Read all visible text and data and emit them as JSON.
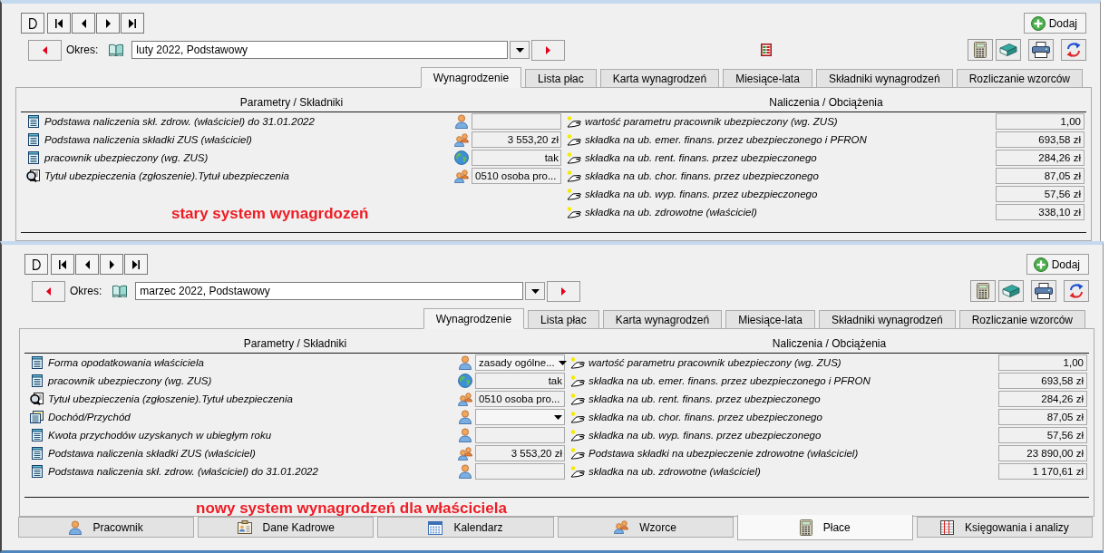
{
  "screens": [
    {
      "period": {
        "label": "Okres:",
        "value": "luty 2022, Podstawowy"
      },
      "indicator": true,
      "add_button": "Dodaj",
      "tabs": [
        {
          "label": "Wynagrodzenie",
          "selected": true
        },
        {
          "label": "Lista płac",
          "selected": false
        },
        {
          "label": "Karta wynagrodzeń",
          "selected": false
        },
        {
          "label": "Miesiące-lata",
          "selected": false
        },
        {
          "label": "Składniki wynagrodzeń",
          "selected": false
        },
        {
          "label": "Rozliczanie wzorców",
          "selected": false
        }
      ],
      "columns": {
        "left": "Parametry / Składniki",
        "right": "Naliczenia / Obciążenia"
      },
      "parameters": [
        {
          "label": "Podstawa naliczenia skł. zdrow. (właściciel) do 31.01.2022",
          "kind": "employee",
          "dropdown": false
        },
        {
          "label": "Podstawa naliczenia składki ZUS (właściciel)",
          "kind": "template",
          "value": "3 553,20 zł",
          "dropdown": false
        },
        {
          "label": "pracownik ubezpieczony (wg. ZUS)",
          "kind": "global",
          "value": "tak",
          "dropdown": false
        },
        {
          "label": "Tytuł ubezpieczenia (zgłoszenie).Tytuł ubezpieczenia",
          "kind": "lookup",
          "value": "0510 osoba pro...",
          "dropdown": false
        }
      ],
      "charges": [
        {
          "label": "wartość parametru pracownik ubezpieczony (wg. ZUS)",
          "value": "1,00"
        },
        {
          "label": "składka na ub. emer. finans. przez ubezpieczonego i PFRON",
          "value": "693,58 zł"
        },
        {
          "label": "składka na ub. rent. finans. przez ubezpieczonego",
          "value": "284,26 zł"
        },
        {
          "label": "składka na ub. chor. finans. przez ubezpieczonego",
          "value": "87,05 zł"
        },
        {
          "label": "składka na ub. wyp. finans. przez ubezpieczonego",
          "value": "57,56 zł"
        },
        {
          "label": "składka na ub. zdrowotne (właściciel)",
          "value": "338,10 zł"
        }
      ],
      "note": "stary system wynagrdozeń"
    },
    {
      "period": {
        "label": "Okres:",
        "value": "marzec 2022, Podstawowy"
      },
      "indicator": false,
      "add_button": "Dodaj",
      "tabs": [
        {
          "label": "Wynagrodzenie",
          "selected": true
        },
        {
          "label": "Lista płac",
          "selected": false
        },
        {
          "label": "Karta wynagrodzeń",
          "selected": false
        },
        {
          "label": "Miesiące-lata",
          "selected": false
        },
        {
          "label": "Składniki wynagrodzeń",
          "selected": false
        },
        {
          "label": "Rozliczanie wzorców",
          "selected": false
        }
      ],
      "columns": {
        "left": "Parametry / Składniki",
        "right": "Naliczenia / Obciążenia"
      },
      "parameters": [
        {
          "label": "Forma opodatkowania właściciela",
          "kind": "employee",
          "value": "zasady ogólne...",
          "dropdown": true
        },
        {
          "label": "pracownik ubezpieczony (wg. ZUS)",
          "kind": "global",
          "value": "tak",
          "dropdown": false
        },
        {
          "label": "Tytuł ubezpieczenia (zgłoszenie).Tytuł ubezpieczenia",
          "kind": "lookup",
          "value": "0510 osoba pro...",
          "dropdown": false
        },
        {
          "label": "Dochód/Przychód",
          "kind": "set",
          "dropdown": true
        },
        {
          "label": "Kwota przychodów uzyskanych w ubiegłym roku",
          "kind": "employee",
          "dropdown": false
        },
        {
          "label": "Podstawa naliczenia składki ZUS (właściciel)",
          "kind": "template",
          "value": "3 553,20 zł",
          "dropdown": false
        },
        {
          "label": "Podstawa naliczenia skł. zdrow. (właściciel) do 31.01.2022",
          "kind": "employee",
          "dropdown": false
        }
      ],
      "charges": [
        {
          "label": "wartość parametru pracownik ubezpieczony (wg. ZUS)",
          "value": "1,00"
        },
        {
          "label": "składka na ub. emer. finans. przez ubezpieczonego i PFRON",
          "value": "693,58 zł"
        },
        {
          "label": "składka na ub. rent. finans. przez ubezpieczonego",
          "value": "284,26 zł"
        },
        {
          "label": "składka na ub. chor. finans. przez ubezpieczonego",
          "value": "87,05 zł"
        },
        {
          "label": "składka na ub. wyp. finans. przez ubezpieczonego",
          "value": "57,56 zł"
        },
        {
          "label": "Podstawa składki na ubezpieczenie zdrowotne (właściciel)",
          "value": "23 890,00 zł"
        },
        {
          "label": "składka na ub. zdrowotne (właściciel)",
          "value": "1 170,61 zł"
        }
      ],
      "note": "nowy system wynagrodzeń dla właściciela",
      "module_tabs": [
        {
          "label": "Pracownik",
          "selected": false
        },
        {
          "label": "Dane Kadrowe",
          "selected": false
        },
        {
          "label": "Kalendarz",
          "selected": false
        },
        {
          "label": "Wzorce",
          "selected": false
        },
        {
          "label": "Płace",
          "selected": true
        },
        {
          "label": "Księgowania i analizy",
          "selected": false
        }
      ]
    }
  ]
}
